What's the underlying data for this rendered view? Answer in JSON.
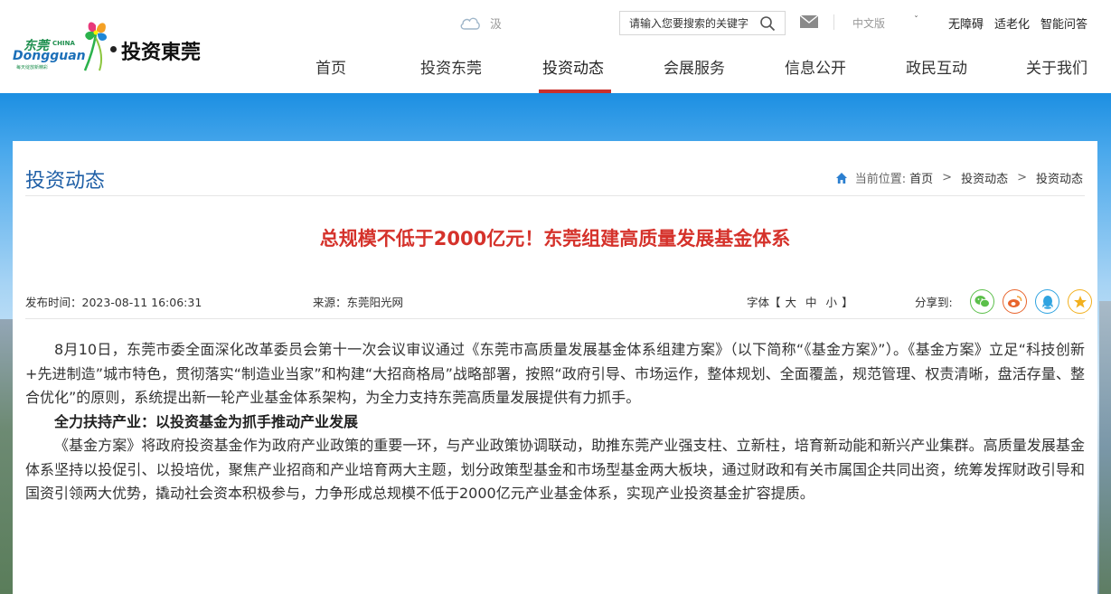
{
  "header": {
    "logo": {
      "dongguan_cn": "东莞",
      "china": "CHINA",
      "dongguan_en": "Dongguan",
      "slogan": "每天绽放新精彩",
      "site_name": "投资東莞"
    },
    "weather_text": "汲",
    "search_placeholder": "请输入您要搜索的关键字",
    "language": "中文版",
    "top_links": [
      "无障碍",
      "适老化",
      "智能问答"
    ],
    "nav": [
      "首页",
      "投资东莞",
      "投资动态",
      "会展服务",
      "信息公开",
      "政民互动",
      "关于我们"
    ],
    "active_nav": "投资动态"
  },
  "section": {
    "title": "投资动态",
    "breadcrumb_label": "当前位置:",
    "breadcrumb": [
      "首页",
      "投资动态",
      "投资动态"
    ]
  },
  "article": {
    "title": "总规模不低于2000亿元！东莞组建高质量发展基金体系",
    "publish_label": "发布时间：",
    "publish_time": "2023-08-11 16:06:31",
    "source_label": "来源：",
    "source": "东莞阳光网",
    "font_label": "字体【",
    "font_sizes": [
      "大",
      "中",
      "小"
    ],
    "font_close": "】",
    "share_label": "分享到:",
    "paragraphs": [
      "8月10日，东莞市委全面深化改革委员会第十一次会议审议通过《东莞市高质量发展基金体系组建方案》（以下简称“《基金方案》”）。《基金方案》立足“科技创新+先进制造”城市特色，贯彻落实“制造业当家”和构建“大招商格局”战略部署，按照“政府引导、市场运作，整体规划、全面覆盖，规范管理、权责清晰，盘活存量、整合优化”的原则，系统提出新一轮产业基金体系架构，为全力支持东莞高质量发展提供有力抓手。",
      "全力扶持产业：以投资基金为抓手推动产业发展",
      "《基金方案》将政府投资基金作为政府产业政策的重要一环，与产业政策协调联动，助推东莞产业强支柱、立新柱，培育新动能和新兴产业集群。高质量发展基金体系坚持以投促引、以投培优，聚焦产业招商和产业培育两大主题，划分政策型基金和市场型基金两大板块，通过财政和有关市属国企共同出资，统筹发挥财政引导和国资引领两大优势，撬动社会资本积极参与，力争形成总规模不低于2000亿元产业基金体系，实现产业投资基金扩容提质。"
    ]
  },
  "colors": {
    "nav_active_bar": "#c9302c",
    "section_title": "#1f5fa6",
    "article_title": "#d5322b",
    "wechat": "#5bbf4a",
    "weibo": "#e8642c",
    "qq": "#2fa3e0",
    "favorite": "#f2b01e"
  }
}
